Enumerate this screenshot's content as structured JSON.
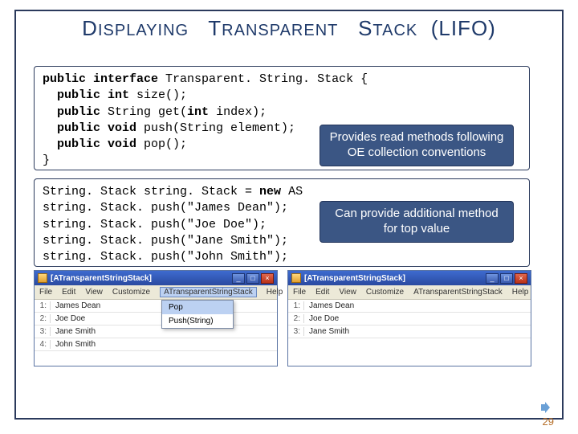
{
  "title": {
    "word1_cap": "D",
    "word1_rest": "ISPLAYING",
    "word2_cap": "T",
    "word2_rest": "RANSPARENT",
    "word3_cap": "S",
    "word3_rest": "TACK",
    "word4": "(LIFO)"
  },
  "code1": {
    "l1a": "public",
    "l1b": " interface",
    "l1c": " Transparent. String. Stack {",
    "l2a": "  public",
    "l2b": " int",
    "l2c": " size();",
    "l3a": "  public",
    "l3b": " String get(",
    "l3c": "int",
    "l3d": " index);",
    "l4a": "  public",
    "l4b": " void",
    "l4c": " push(String element);",
    "l5a": "  public",
    "l5b": " void",
    "l5c": " pop();",
    "l6": "}"
  },
  "code2": {
    "l1a": "String. Stack string. Stack = ",
    "l1b": "new",
    "l1c": " AS",
    "l2": "string. Stack. push(\"James Dean\");",
    "l3": "string. Stack. push(\"Joe Doe\");",
    "l4": "string. Stack. push(\"Jane Smith\");",
    "l5": "string. Stack. push(\"John Smith\");"
  },
  "callout1": "Provides read methods following OE collection conventions",
  "callout2": "Can provide additional method for top value",
  "app": {
    "title": "[ATransparentStringStack]",
    "menus": [
      "File",
      "Edit",
      "View",
      "Customize",
      "ATransparentStringStack",
      "Help"
    ],
    "dropdown": [
      "Pop",
      "Push(String)"
    ],
    "rows4": [
      {
        "idx": "1:",
        "val": "James Dean"
      },
      {
        "idx": "2:",
        "val": "Joe Doe"
      },
      {
        "idx": "3:",
        "val": "Jane Smith"
      },
      {
        "idx": "4:",
        "val": "John Smith"
      }
    ],
    "rows3": [
      {
        "idx": "1:",
        "val": "James Dean"
      },
      {
        "idx": "2:",
        "val": "Joe Doe"
      },
      {
        "idx": "3:",
        "val": "Jane Smith"
      }
    ]
  },
  "win_controls": {
    "min": "_",
    "max": "□",
    "close": "×"
  },
  "slide_number": "29"
}
